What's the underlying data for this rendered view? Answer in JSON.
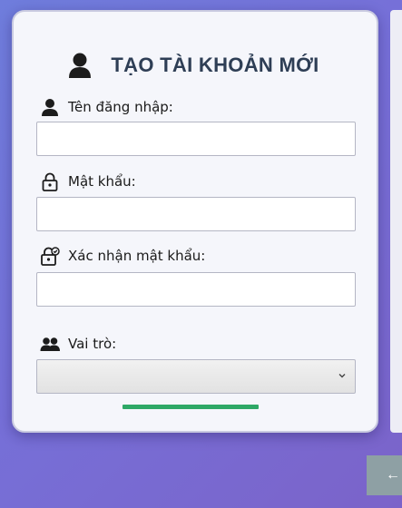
{
  "form": {
    "title": "TẠO TÀI KHOẢN MỚI",
    "username_label": "Tên đăng nhập:",
    "username_value": "",
    "password_label": "Mật khẩu:",
    "password_value": "",
    "confirm_label": "Xác nhận mật khẩu:",
    "confirm_value": "",
    "role_label": "Vai trò:",
    "role_selected": ""
  },
  "corner_button_label": "←",
  "colors": {
    "accent_green": "#2ea866",
    "title_color": "#2e3e55"
  }
}
